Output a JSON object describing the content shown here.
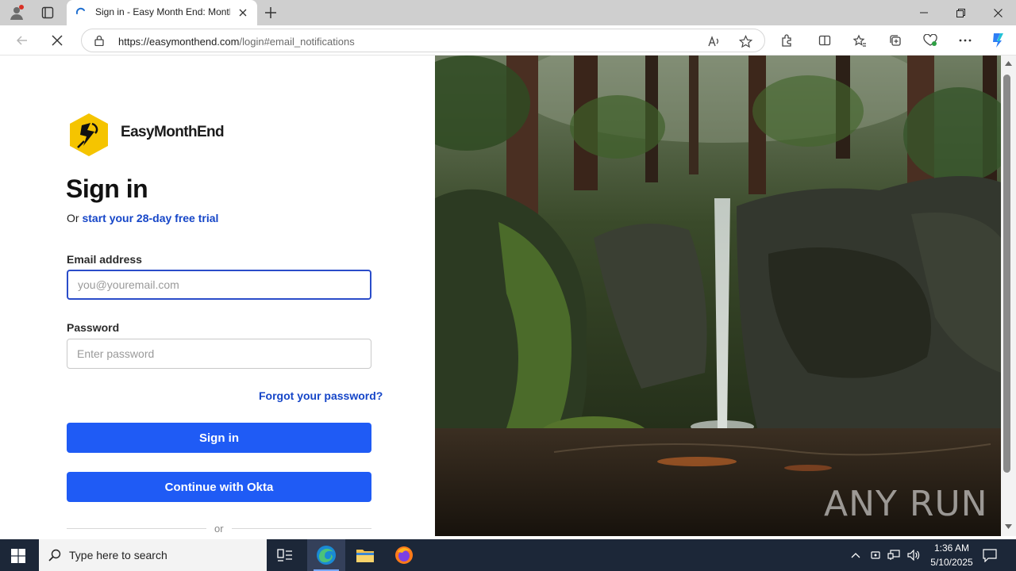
{
  "browser": {
    "tab_title": "Sign in - Easy Month End: Month",
    "url_host": "https://easymonthend.com",
    "url_path": "/login#email_notifications"
  },
  "page": {
    "brand_name": "EasyMonthEnd",
    "heading": "Sign in",
    "trial_prefix": "Or",
    "trial_link": "start your 28-day free trial",
    "email_label": "Email address",
    "email_placeholder": "you@youremail.com",
    "email_value": "",
    "password_label": "Password",
    "password_placeholder": "Enter password",
    "forgot_link": "Forgot your password?",
    "sign_in_button": "Sign in",
    "okta_button": "Continue with Okta",
    "divider_text": "or",
    "accent_color": "#1f5bf5",
    "brand_color": "#f5c400"
  },
  "watermark": "ANY RUN",
  "taskbar": {
    "search_placeholder": "Type here to search",
    "time": "1:36 AM",
    "date": "5/10/2025"
  }
}
